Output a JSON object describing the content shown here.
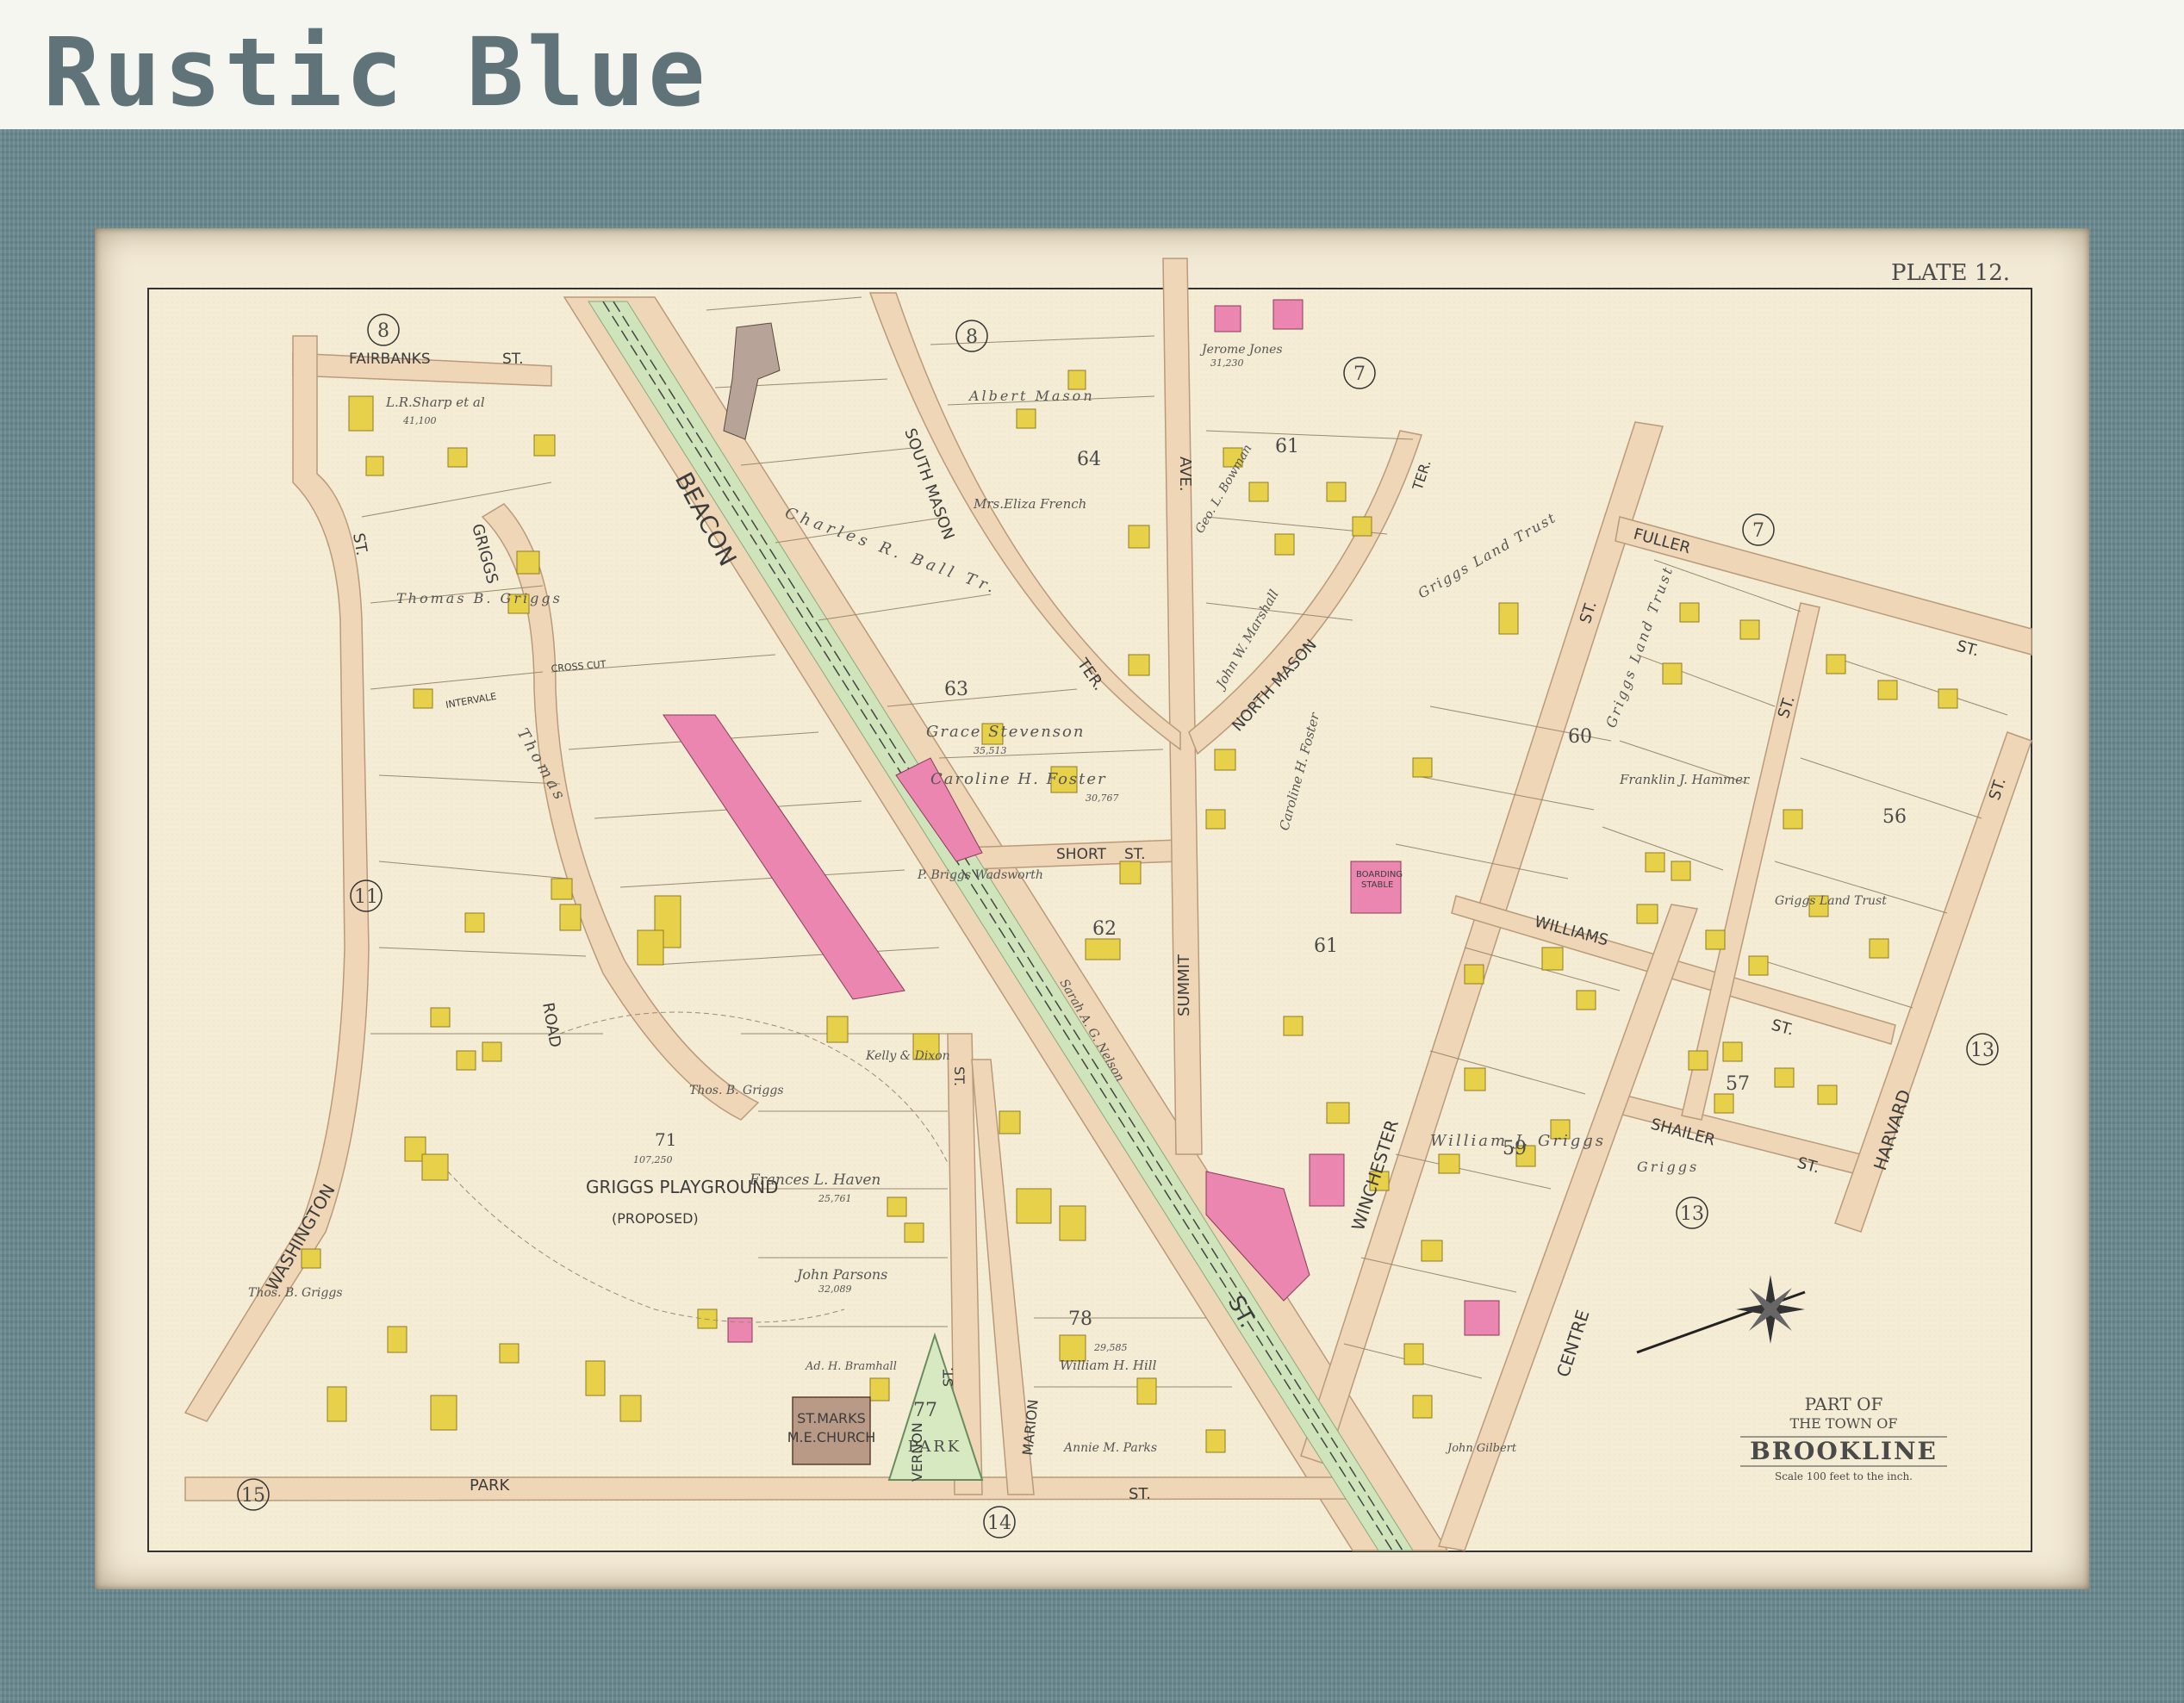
{
  "header": {
    "title": "Rustic Blue"
  },
  "plate": "PLATE 12.",
  "title_block": {
    "line1": "PART OF",
    "line2": "THE TOWN OF",
    "line3": "BROOKLINE",
    "scale": "Scale 100 feet to the inch."
  },
  "sections": [
    "8",
    "8",
    "7",
    "7",
    "11",
    "13",
    "13",
    "15",
    "14"
  ],
  "block_numbers": [
    "64",
    "63",
    "62",
    "61",
    "61",
    "60",
    "56",
    "57",
    "59",
    "71",
    "78",
    "77"
  ],
  "streets": {
    "fairbanks": "FAIRBANKS",
    "st": "ST.",
    "beacon": "BEACON",
    "south_mason": "SOUTH MASON",
    "ter": "TER.",
    "north_mason": "NORTH MASON",
    "ave": "AVE.",
    "summit": "SUMMIT",
    "fuller": "FULLER",
    "williams": "WILLIAMS",
    "shailer": "SHAILER",
    "harvard": "HARVARD",
    "winchester": "WINCHESTER",
    "centre": "CENTRE",
    "griggs": "GRIGGS",
    "road": "ROAD",
    "washington": "WASHINGTON",
    "park": "PARK",
    "vernon": "VERNON",
    "marion": "MARION",
    "short": "SHORT",
    "intervale": "INTERVALE",
    "cross_cut": "CROSS CUT"
  },
  "landmarks": {
    "playground": "GRIGGS PLAYGROUND",
    "proposed": "(PROPOSED)",
    "church_line1": "ST.MARKS",
    "church_line2": "M.E.CHURCH",
    "park": "PARK",
    "boarding_stable_1": "BOARDING",
    "boarding_stable_2": "STABLE"
  },
  "owners": {
    "sharp": "L.R.Sharp et al",
    "thomas_griggs": "Thomas B. Griggs",
    "thomas_short": "Thomas",
    "albert_mason": "Albert Mason",
    "eliza_french": "Mrs.Eliza French",
    "charles_ball": "Charles R. Ball Tr.",
    "grace_stevenson": "Grace Stevenson",
    "caroline_foster": "Caroline H. Foster",
    "jerome_jones": "Jerome Jones",
    "griggs_land_trust": "Griggs Land Trust",
    "griggs_land": "Griggs Land Trust",
    "caroline_foster_2": "Caroline H. Foster",
    "john_marshall": "John W. Marshall",
    "frances_haven": "Frances L. Haven",
    "john_parsons": "John Parsons",
    "william_hill": "William H. Hill",
    "william_griggs": "William J. Griggs",
    "franklin_hammer": "Franklin J. Hammer",
    "thos_griggs": "Thos. B. Griggs",
    "annie_parks": "Annie M. Parks",
    "griggs_v": "Griggs",
    "p_wadsworth": "P. Briggs Wadsworth",
    "sarah_nelson": "Sarah A. G. Nelson",
    "geo_bowman": "Geo. L. Bowman",
    "amos_griggs": "Griggs",
    "kelly_dixon": "Kelly & Dixon",
    "john_gilbert": "John Gilbert",
    "ad_bramhall": "Ad. H. Bramhall"
  },
  "areas": {
    "sharp": "41,100",
    "charles_ball": "",
    "grace_stevenson": "35,513",
    "caroline_foster": "30,767",
    "jerome_jones": "31,230",
    "playground": "107,250",
    "frances_haven": "25,761",
    "john_parsons": "32,089",
    "william_hill": "29,585"
  }
}
